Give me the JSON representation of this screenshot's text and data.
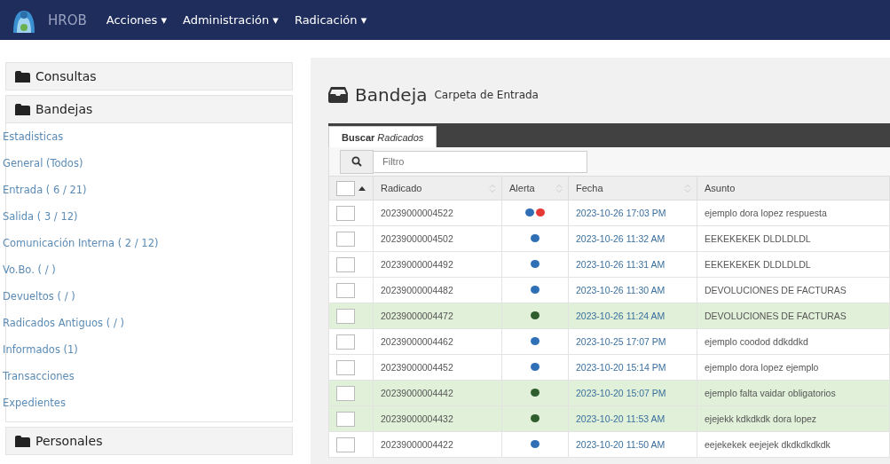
{
  "navbar": {
    "brand": "HROB",
    "menus": [
      {
        "label": "Acciones",
        "caret": "▾"
      },
      {
        "label": "Administración",
        "caret": "▾"
      },
      {
        "label": "Radicación",
        "caret": "▾"
      }
    ]
  },
  "sidebar": {
    "sections": [
      {
        "title": "Consultas"
      },
      {
        "title": "Bandejas",
        "items": [
          "Estadisticas",
          "General (Todos)",
          "Entrada ( 6 / 21)",
          "Salida ( 3 / 12)",
          "Comunicación Interna ( 2 / 12)",
          "Vo.Bo. ( / )",
          "Devueltos ( / )",
          "Radicados Antiguos ( / )",
          "Informados (1)",
          "Transacciones",
          "Expedientes"
        ]
      },
      {
        "title": "Personales"
      }
    ]
  },
  "page": {
    "title": "Bandeja",
    "subtitle": "Carpeta de Entrada"
  },
  "tabs": [
    {
      "label": "**Buscar** *Radicados*",
      "selected": true
    }
  ],
  "search": {
    "placeholder": "Filtro"
  },
  "table": {
    "select_all_checked": false,
    "columns": [
      "Radicado",
      "Alerta",
      "Fecha",
      "Asunto"
    ],
    "rows": [
      {
        "radicado": "20239000004522",
        "alerts": [
          {
            "color": "#2f6fb5"
          },
          {
            "color": "#e53935"
          }
        ],
        "fecha": "2023-10-26 17:03 PM",
        "asunto": "ejemplo dora lopez respuesta",
        "highlighted": false,
        "checked": false
      },
      {
        "radicado": "20239000004502",
        "alerts": [
          {
            "color": "#2f6fb5"
          }
        ],
        "fecha": "2023-10-26 11:32 AM",
        "asunto": "EEKEKEKEK DLDLDLDL",
        "highlighted": false,
        "checked": false
      },
      {
        "radicado": "20239000004492",
        "alerts": [
          {
            "color": "#2f6fb5"
          }
        ],
        "fecha": "2023-10-26 11:31 AM",
        "asunto": "EEKEKEKEK DLDLDLDL",
        "highlighted": false,
        "checked": false
      },
      {
        "radicado": "20239000004482",
        "alerts": [
          {
            "color": "#2f6fb5"
          }
        ],
        "fecha": "2023-10-26 11:30 AM",
        "asunto": "DEVOLUCIONES DE FACTURAS",
        "highlighted": false,
        "checked": false
      },
      {
        "radicado": "20239000004472",
        "alerts": [
          {
            "color": "#2e5e2e"
          }
        ],
        "fecha": "2023-10-26 11:24 AM",
        "asunto": "DEVOLUCIONES DE FACTURAS",
        "highlighted": true,
        "checked": false
      },
      {
        "radicado": "20239000004462",
        "alerts": [
          {
            "color": "#2f6fb5"
          }
        ],
        "fecha": "2023-10-25 17:07 PM",
        "asunto": "ejemplo coodod ddkddkd",
        "highlighted": false,
        "checked": false
      },
      {
        "radicado": "20239000004452",
        "alerts": [
          {
            "color": "#2f6fb5"
          }
        ],
        "fecha": "2023-10-20 15:14 PM",
        "asunto": "ejemplo dora lopez ejemplo",
        "highlighted": false,
        "checked": false
      },
      {
        "radicado": "20239000004442",
        "alerts": [
          {
            "color": "#2e5e2e"
          }
        ],
        "fecha": "2023-10-20 15:07 PM",
        "asunto": "ejemplo falta vaidar obligatorios",
        "highlighted": true,
        "checked": false
      },
      {
        "radicado": "20239000004432",
        "alerts": [
          {
            "color": "#2e5e2e"
          }
        ],
        "fecha": "2023-10-20 11:53 AM",
        "asunto": "ejejekk kdkdkdk dora lopez",
        "highlighted": true,
        "checked": false
      },
      {
        "radicado": "20239000004422",
        "alerts": [
          {
            "color": "#2f6fb5"
          }
        ],
        "fecha": "2023-10-20 11:50 AM",
        "asunto": "eejekekek eejejek dkdkdkdkdk",
        "highlighted": false,
        "checked": false
      }
    ]
  }
}
